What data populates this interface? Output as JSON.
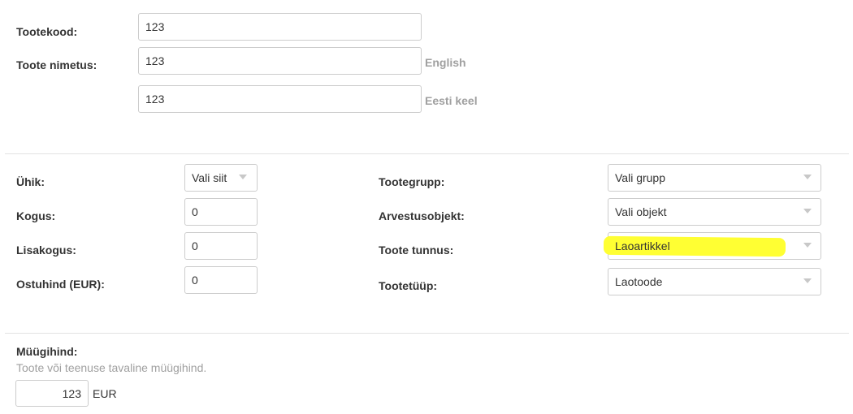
{
  "product": {
    "code_label": "Tootekood:",
    "code_value": "123",
    "name_label": "Toote nimetus:",
    "name_en_value": "123",
    "name_en_lang": "English",
    "name_et_value": "123",
    "name_et_lang": "Eesti keel"
  },
  "left_fields": {
    "unit_label": "Ühik:",
    "unit_select": "Vali siit",
    "quantity_label": "Kogus:",
    "quantity_value": "0",
    "extra_quantity_label": "Lisakogus:",
    "extra_quantity_value": "0",
    "purchase_price_label": "Ostuhind (EUR):",
    "purchase_price_value": "0"
  },
  "right_fields": {
    "group_label": "Tootegrupp:",
    "group_select": "Vali grupp",
    "accounting_object_label": "Arvestusobjekt:",
    "accounting_object_select": "Vali objekt",
    "product_tag_label": "Toote tunnus:",
    "product_tag_select": "Laoartikkel",
    "product_type_label": "Tootetüüp:",
    "product_type_select": "Laotoode"
  },
  "sale_price": {
    "label": "Müügihind:",
    "hint": "Toote või teenuse tavaline müügihind.",
    "value": "123",
    "currency": "EUR"
  },
  "colors": {
    "highlight": "#ffff33",
    "border": "#cccccc",
    "muted_text": "#a0a0a0"
  }
}
